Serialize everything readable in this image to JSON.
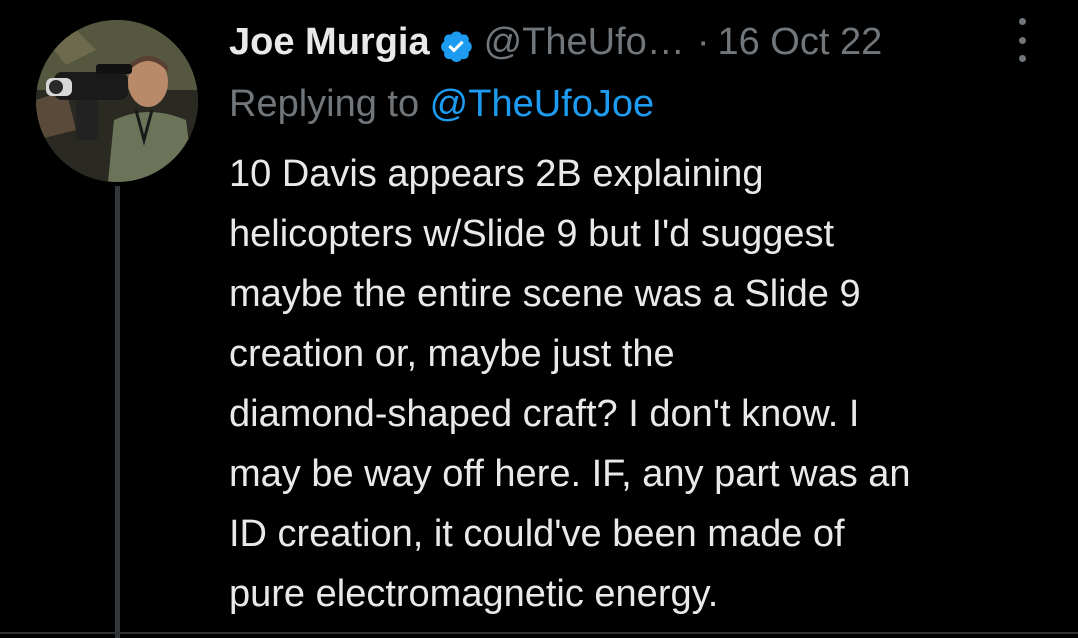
{
  "colors": {
    "background": "#000000",
    "primary_text": "#e7e9ea",
    "secondary_text": "#71767b",
    "link": "#1d9bf0",
    "verified_badge": "#1d9bf0",
    "thread_line": "#333639"
  },
  "tweet": {
    "author": {
      "display_name": "Joe Murgia",
      "verified_icon": "verified-badge-icon",
      "handle": "@TheUfo…"
    },
    "separator": "·",
    "date": "16 Oct 22",
    "more_icon": "more-vertical-icon",
    "reply": {
      "prefix": "Replying to ",
      "mention": "@TheUfoJoe"
    },
    "body_lines": [
      "10 Davis appears 2B explaining",
      "helicopters w/Slide 9 but I'd suggest",
      "maybe the entire scene was a Slide 9",
      "creation or, maybe just the",
      "diamond-shaped craft? I don't know. I",
      "may be way off here. IF, any part was an",
      "ID creation, it could've been made of",
      "pure electromagnetic energy."
    ]
  }
}
